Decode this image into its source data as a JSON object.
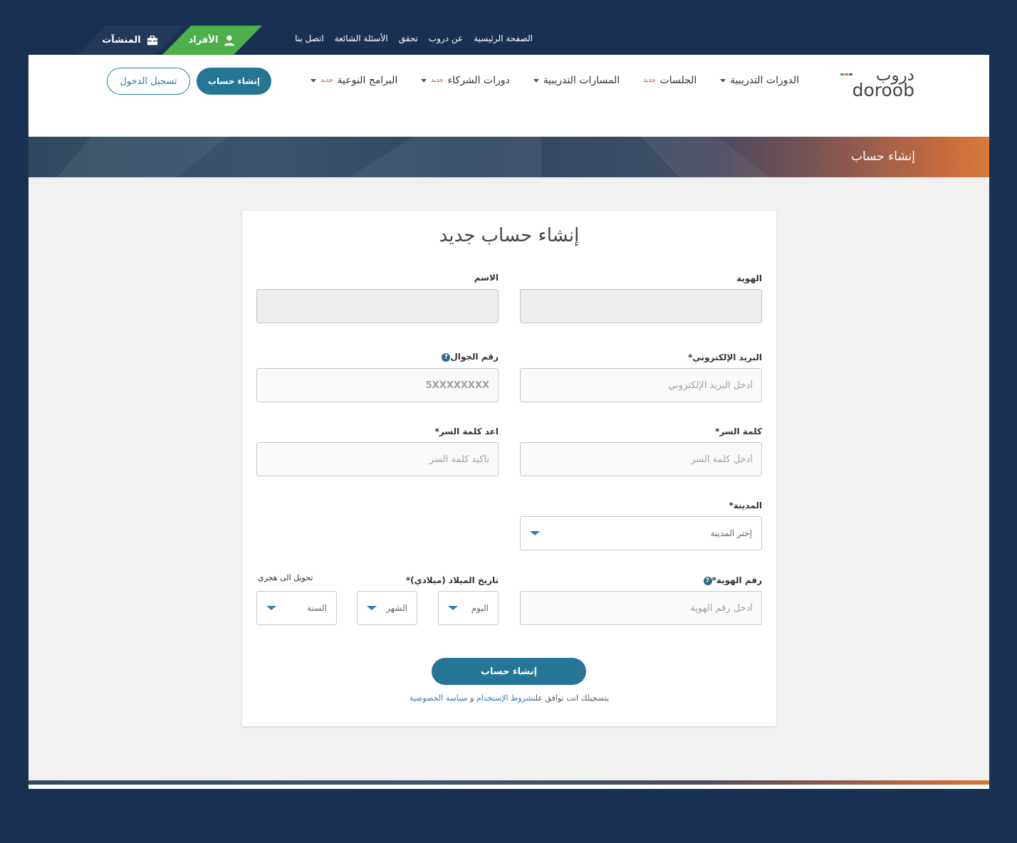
{
  "topbar": {
    "links": [
      "الصفحة الرئيسية",
      "عن دروب",
      "تحقق",
      "الأسئلة الشائعة",
      "اتصل بنا"
    ],
    "individuals_label": "الأفراد",
    "organizations_label": "المنشآت"
  },
  "header": {
    "logo_ar": "دروب",
    "logo_en": "doroob",
    "nav": [
      {
        "label": "الدورات التدريبية",
        "badge": "",
        "dropdown": true
      },
      {
        "label": "الجلسات",
        "badge": "جديد",
        "dropdown": false
      },
      {
        "label": "المسارات التدريبية",
        "badge": "",
        "dropdown": true
      },
      {
        "label": "دورات الشركاء",
        "badge": "جديد",
        "dropdown": true
      },
      {
        "label": "البرامج النوعية",
        "badge": "جديد",
        "dropdown": true
      }
    ],
    "register_label": "إنشاء حساب",
    "login_label": "تسجيل الدخول"
  },
  "banner": {
    "title": "إنشاء حساب"
  },
  "form": {
    "title": "إنشاء حساب جديد",
    "identity_label": "الهوية",
    "name_label": "الاسم",
    "email_label": "البريد الإلكتروني*",
    "email_placeholder": "أدخل البريد الإلكتروني",
    "mobile_label": "رقم الجوال",
    "mobile_placeholder": "5XXXXXXXX",
    "password_label": "كلمة السر*",
    "password_placeholder": "أدخل كلمة السر",
    "confirm_label": "اعد كلمة السر*",
    "confirm_placeholder": "تأكيد كلمة السر",
    "city_label": "المدينة*",
    "city_value": "إختر المدينة",
    "id_number_label": "رقم الهوية*",
    "id_number_placeholder": "أدخل رقم الهوية",
    "dob_label": "تاريخ الميلاد (ميلادي)*",
    "hijri_link": "تحويل الى هجري",
    "day_value": "اليوم",
    "month_value": "الشهر",
    "year_value": "السنة",
    "submit_label": "إنشاء حساب",
    "terms_prefix": "بتسجيلك انت توافق على",
    "terms_link": "شروط الإستخدام",
    "terms_and": " و ",
    "privacy_link": "سياسة الخصوصية"
  }
}
